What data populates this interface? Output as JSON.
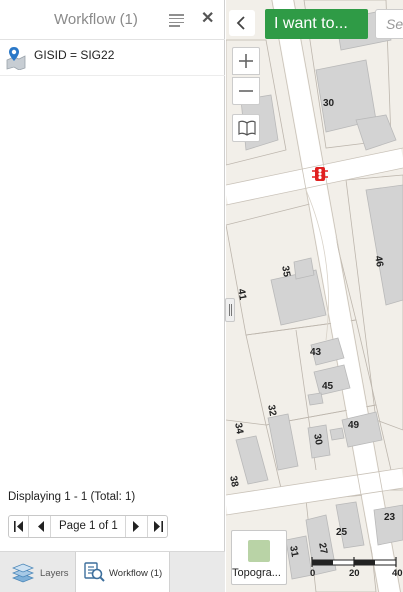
{
  "panel": {
    "title": "Workflow (1)",
    "results": [
      {
        "label": "GISID = SIG22"
      }
    ],
    "status": "Displaying 1 - 1 (Total: 1)",
    "pager": {
      "page_label": "Page 1 of 1"
    },
    "tabs": [
      {
        "label": "Layers"
      },
      {
        "label": "Workflow (1)"
      }
    ]
  },
  "toolbar": {
    "i_want_to_label": "I want to...",
    "search_placeholder": "Search"
  },
  "map": {
    "basemap_label": "Topogra...",
    "parcel_numbers": [
      "30",
      "46",
      "35",
      "41",
      "43",
      "45",
      "32",
      "49",
      "34",
      "30",
      "38",
      "25",
      "23",
      "27",
      "31"
    ],
    "scale_labels": [
      "0",
      "20",
      "40"
    ]
  },
  "colors": {
    "accent_green": "#2f9b46",
    "building_fill": "#d3d3d3",
    "map_background": "#f2efe9",
    "highlight_marker": "#e02020"
  }
}
